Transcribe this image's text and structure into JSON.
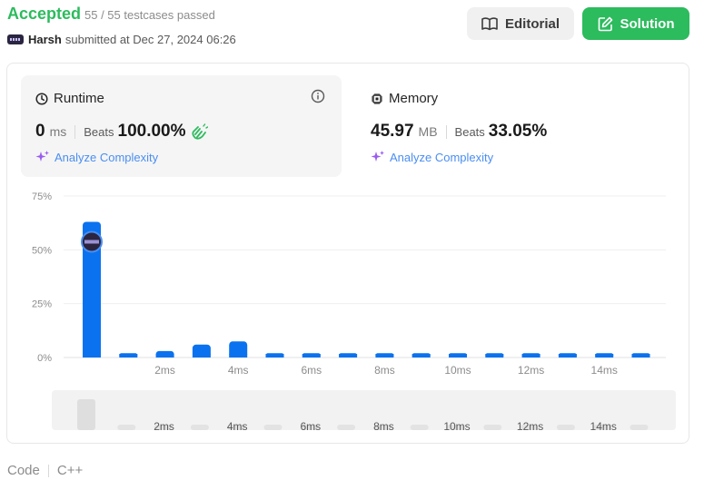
{
  "header": {
    "status": "Accepted",
    "testcases": "55 / 55 testcases passed",
    "user": "Harsh",
    "submitted": "submitted at Dec 27, 2024 06:26",
    "editorial_label": "Editorial",
    "solution_label": "Solution",
    "accent": "#2cbb5d"
  },
  "runtime": {
    "title": "Runtime",
    "value": "0",
    "unit": "ms",
    "beats_label": "Beats",
    "beats": "100.00%",
    "analyze": "Analyze Complexity"
  },
  "memory": {
    "title": "Memory",
    "value": "45.97",
    "unit": "MB",
    "beats_label": "Beats",
    "beats": "33.05%",
    "analyze": "Analyze Complexity"
  },
  "chart_data": {
    "type": "bar",
    "ylim": [
      0,
      75
    ],
    "yticks": [
      "75%",
      "50%",
      "25%",
      "0%"
    ],
    "ytick_values": [
      75,
      50,
      25,
      0
    ],
    "categories": [
      "0ms",
      "1ms",
      "2ms",
      "3ms",
      "4ms",
      "5ms",
      "6ms",
      "7ms",
      "8ms",
      "9ms",
      "10ms",
      "11ms",
      "12ms",
      "13ms",
      "14ms",
      "15ms"
    ],
    "values": [
      63,
      2,
      3,
      6,
      7.5,
      2,
      2,
      2,
      2,
      2,
      2,
      2,
      2,
      2,
      2,
      2
    ],
    "xtick_labels": [
      "2ms",
      "4ms",
      "6ms",
      "8ms",
      "10ms",
      "12ms",
      "14ms"
    ],
    "xtick_indices": [
      2,
      4,
      6,
      8,
      10,
      12,
      14
    ],
    "highlight_index": 0,
    "bar_color": "#0a72ef"
  },
  "overview": {
    "xtick_labels": [
      "2ms",
      "4ms",
      "6ms",
      "8ms",
      "10ms",
      "12ms",
      "14ms"
    ]
  },
  "footer": {
    "code_label": "Code",
    "language": "C++"
  }
}
